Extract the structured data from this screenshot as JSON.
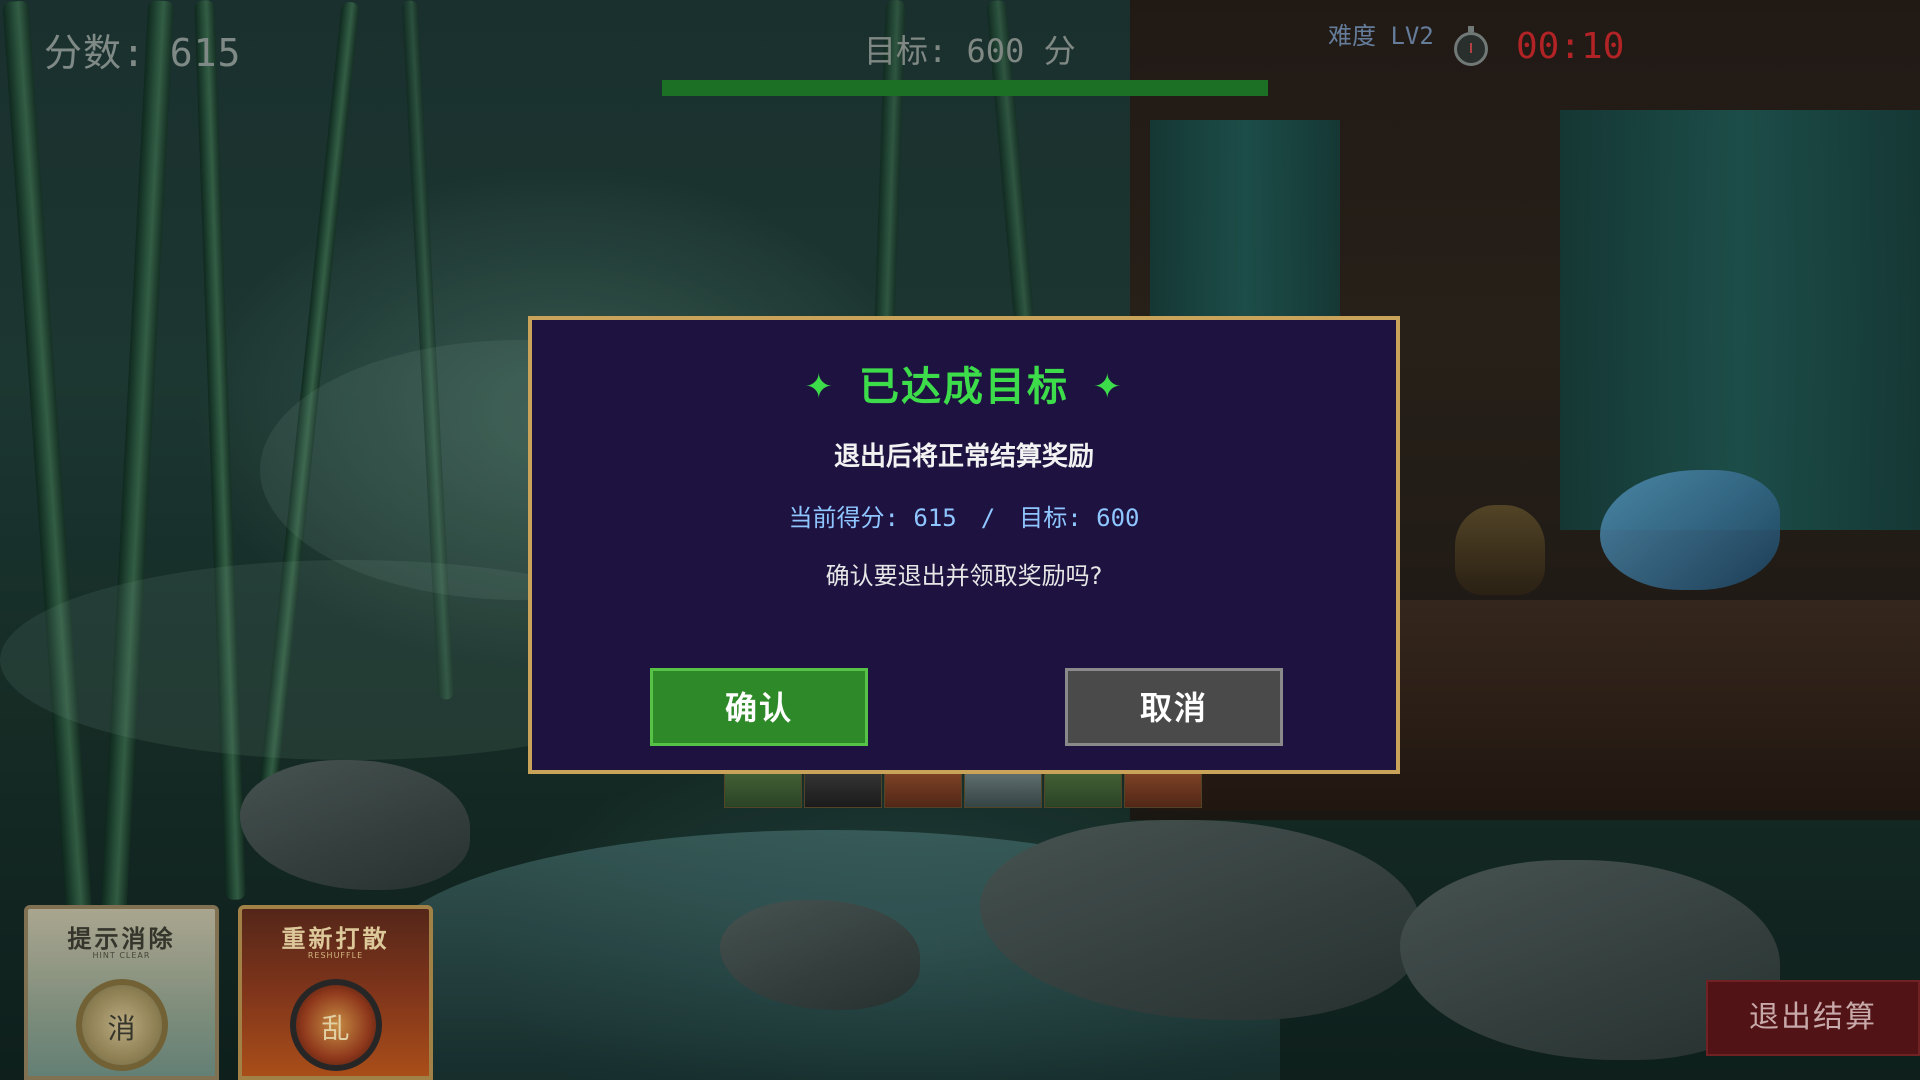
{
  "hud": {
    "score_label": "分数: 615",
    "target_label": "目标: 600 分",
    "progress_fraction": 1.0,
    "progress_color": "#1f7a2a",
    "difficulty": "难度 LV2",
    "timer_icon": "stopwatch-icon",
    "timer": "00:10",
    "timer_color": "#c2262a"
  },
  "skills": {
    "hint": {
      "title": "提示消除",
      "subtitle": "HINT CLEAR",
      "emblem": "消"
    },
    "shuffle": {
      "title": "重新打散",
      "subtitle": "RESHUFFLE",
      "emblem": "乱"
    }
  },
  "exit_button_label": "退出结算",
  "dialog": {
    "title": "已达成目标",
    "sparkle_icon": "✦",
    "subtitle": "退出后将正常结算奖励",
    "current_score_label": "当前得分: 615",
    "separator": "/",
    "target_label": "目标: 600",
    "question": "确认要退出并领取奖励吗?",
    "confirm_label": "确认",
    "cancel_label": "取消",
    "title_color": "#3ddc4a",
    "border_color": "#c9a35a",
    "background_color": "#1d1240"
  }
}
